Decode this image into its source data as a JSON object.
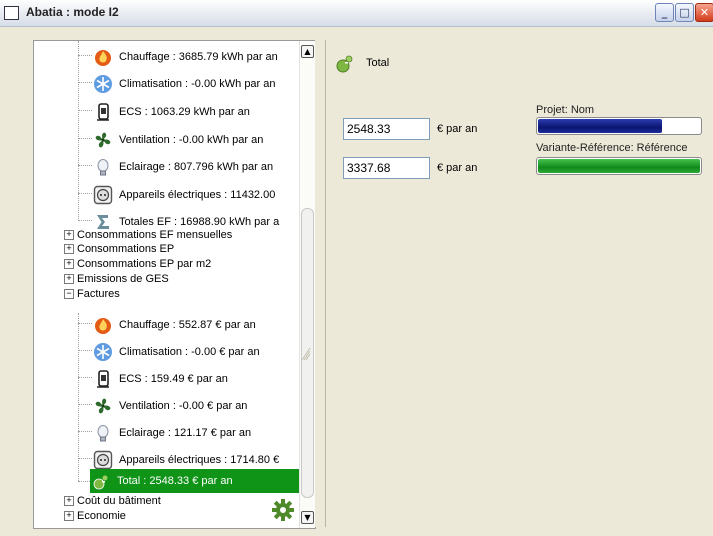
{
  "window": {
    "title": "Abatia : mode I2",
    "buttons": {
      "minimize": "_",
      "maximize": "□",
      "close": "✕"
    }
  },
  "tree": {
    "consommations_ef_items": [
      {
        "icon": "fire-icon",
        "label": "Chauffage : 3685.79 kWh par an"
      },
      {
        "icon": "snowflake-icon",
        "label": "Climatisation : -0.00 kWh par an"
      },
      {
        "icon": "water-heater-icon",
        "label": "ECS : 1063.29 kWh par an"
      },
      {
        "icon": "fan-icon",
        "label": "Ventilation : -0.00 kWh par an"
      },
      {
        "icon": "light-bulb-icon",
        "label": "Eclairage : 807.796 kWh par an"
      },
      {
        "icon": "electric-appliance-icon",
        "label": "Appareils électriques : 11432.00"
      },
      {
        "icon": "sigma-icon",
        "label": "Totales EF : 16988.90 kWh par a"
      }
    ],
    "groups": [
      {
        "expander": "+",
        "label": "Consommations EF mensuelles"
      },
      {
        "expander": "+",
        "label": "Consommations EP"
      },
      {
        "expander": "+",
        "label": "Consommations EP par m2"
      },
      {
        "expander": "+",
        "label": "Emissions de GES"
      },
      {
        "expander": "−",
        "label": "Factures"
      }
    ],
    "factures_items": [
      {
        "icon": "fire-icon",
        "label": "Chauffage : 552.87 € par an"
      },
      {
        "icon": "snowflake-icon",
        "label": "Climatisation : -0.00 € par an"
      },
      {
        "icon": "water-heater-icon",
        "label": "ECS : 159.49 € par an"
      },
      {
        "icon": "fan-icon",
        "label": "Ventilation : -0.00 € par an"
      },
      {
        "icon": "light-bulb-icon",
        "label": "Eclairage : 121.17 € par an"
      },
      {
        "icon": "electric-appliance-icon",
        "label": "Appareils électriques : 1714.80 €"
      },
      {
        "icon": "money-bag-icon",
        "label": "Total : 2548.33 € par an",
        "selected": true
      }
    ],
    "bottom_groups": [
      {
        "expander": "+",
        "label": "Coût du bâtiment"
      },
      {
        "expander": "+",
        "label": "Economie"
      }
    ]
  },
  "detail": {
    "title": "Total",
    "values": [
      {
        "value": "2548.33",
        "unit": "€ par an"
      },
      {
        "value": "3337.68",
        "unit": "€ par an"
      }
    ],
    "bars": [
      {
        "caption": "Projet: Nom",
        "fraction": 0.7635,
        "color": "#0b1673"
      },
      {
        "caption": "Variante-Référence: Référence",
        "fraction": 1.0,
        "color": "#0f8a1c"
      }
    ]
  }
}
